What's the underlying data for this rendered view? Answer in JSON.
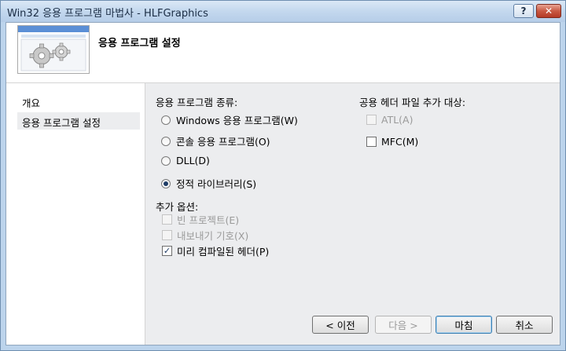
{
  "window": {
    "title": "Win32 응용 프로그램 마법사 - HLFGraphics"
  },
  "titlebar": {
    "help_label": "?",
    "close_label": "✕"
  },
  "header": {
    "title": "응용 프로그램 설정"
  },
  "nav": {
    "items": [
      {
        "label": "개요"
      },
      {
        "label": "응용 프로그램 설정"
      }
    ]
  },
  "app_type": {
    "heading": "응용 프로그램 종류:",
    "options": [
      {
        "label": "Windows 응용 프로그램(W)",
        "selected": false
      },
      {
        "label": "콘솔 응용 프로그램(O)",
        "selected": false
      },
      {
        "label": "DLL(D)",
        "selected": false
      },
      {
        "label": "정적 라이브러리(S)",
        "selected": true
      }
    ]
  },
  "extra_options": {
    "heading": "추가 옵션:",
    "items": [
      {
        "label": "빈 프로젝트(E)",
        "checked": false,
        "enabled": false
      },
      {
        "label": "내보내기 기호(X)",
        "checked": false,
        "enabled": false
      },
      {
        "label": "미리 컴파일된 헤더(P)",
        "checked": true,
        "enabled": true
      }
    ]
  },
  "common_headers": {
    "heading": "공용 헤더 파일 추가 대상:",
    "items": [
      {
        "label": "ATL(A)",
        "checked": false,
        "enabled": false
      },
      {
        "label": "MFC(M)",
        "checked": false,
        "enabled": true
      }
    ]
  },
  "buttons": {
    "prev": "< 이전",
    "next": "다음 >",
    "finish": "마침",
    "cancel": "취소"
  }
}
